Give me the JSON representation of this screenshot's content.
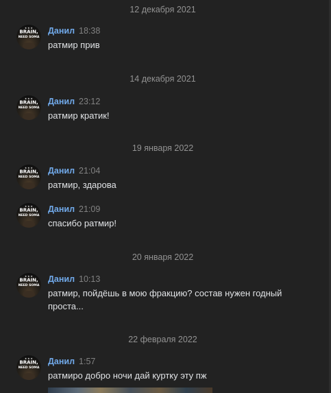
{
  "messages_date_groups": [
    {
      "date": "12 декабря 2021",
      "messages": [
        {
          "author": "Данил",
          "time": "18:38",
          "text": "ратмир прив"
        }
      ]
    },
    {
      "date": "14 декабря 2021",
      "messages": [
        {
          "author": "Данил",
          "time": "23:12",
          "text": "ратмир кратик!"
        }
      ]
    },
    {
      "date": "19 января 2022",
      "messages": [
        {
          "author": "Данил",
          "time": "21:04",
          "text": "ратмир, здарова"
        },
        {
          "author": "Данил",
          "time": "21:09",
          "text": "спасибо ратмир!"
        }
      ]
    },
    {
      "date": "20 января 2022",
      "messages": [
        {
          "author": "Данил",
          "time": "10:13",
          "text": "ратмир, пойдёшь в мою фракцию? состав нужен годный проста..."
        }
      ]
    },
    {
      "date": "22 февраля 2022",
      "messages": [
        {
          "author": "Данил",
          "time": "1:57",
          "text": "ратмиро добро ночи дай куртку эту пж"
        }
      ]
    }
  ],
  "avatar": {
    "line1": "BRAIN,",
    "line2": "NEED SOMA"
  },
  "colors": {
    "background": "#222222",
    "author": "#71aaeb",
    "message_text": "#e1e3e6",
    "date_separator": "#939393",
    "time": "#828282"
  }
}
